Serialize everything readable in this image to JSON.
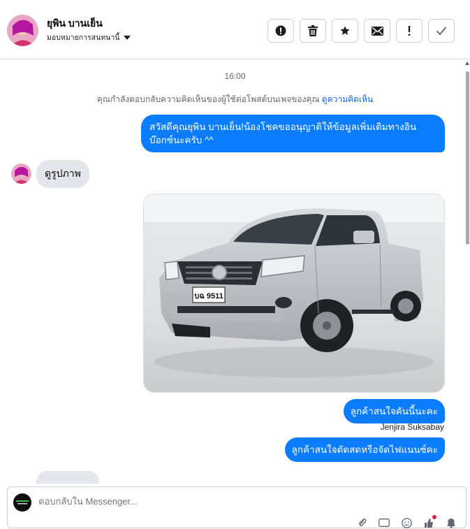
{
  "header": {
    "contact_name": "ยุพิน บานเย็น",
    "assign_label": "มอบหมายการสนทนานี้",
    "actions": [
      {
        "name": "spam-button",
        "icon": "alert-circle-icon"
      },
      {
        "name": "delete-button",
        "icon": "trash-icon"
      },
      {
        "name": "star-button",
        "icon": "star-icon"
      },
      {
        "name": "mark-unread-button",
        "icon": "envelope-icon"
      },
      {
        "name": "follow-up-button",
        "icon": "exclamation-icon"
      },
      {
        "name": "mark-done-button",
        "icon": "check-icon"
      }
    ]
  },
  "thread": {
    "timestamp": "16:00",
    "system_message": "คุณกำลังตอบกลับความคิดเห็นของผู้ใช้ต่อโพสต์บนเพจของคุณ",
    "system_link": "ดูความคิดเห็น",
    "messages": [
      {
        "direction": "out",
        "text": "สวัสดีคุณยุพิน บานเย็น!น้องโชคขออนุญาติให้ข้อมูลเพิ่มเติมทางอินบ๊อกซ์นะครับ ^^"
      },
      {
        "direction": "in",
        "text": "ดูรูปภาพ"
      },
      {
        "direction": "out",
        "type": "image",
        "alt": "silver pickup truck photo",
        "plate": "บฉ 9511"
      },
      {
        "direction": "out",
        "text": "ลูกค้าสนใจคันนี้นะคะ"
      },
      {
        "direction": "out",
        "text": "ลูกค้าสนใจตัดสดหรือจัดไฟแนนซ์คะ"
      }
    ],
    "sender_name": "Jenjira Suksabay"
  },
  "composer": {
    "placeholder": "ตอบกลับใน Messenger...",
    "icons": [
      "attachment-icon",
      "gif-icon",
      "emoji-icon",
      "like-icon",
      "bell-icon"
    ]
  },
  "colors": {
    "outgoing_bubble": "#0a7cff",
    "incoming_bubble": "#e4e6eb",
    "link": "#1b63d6",
    "muted_text": "#65676b"
  }
}
